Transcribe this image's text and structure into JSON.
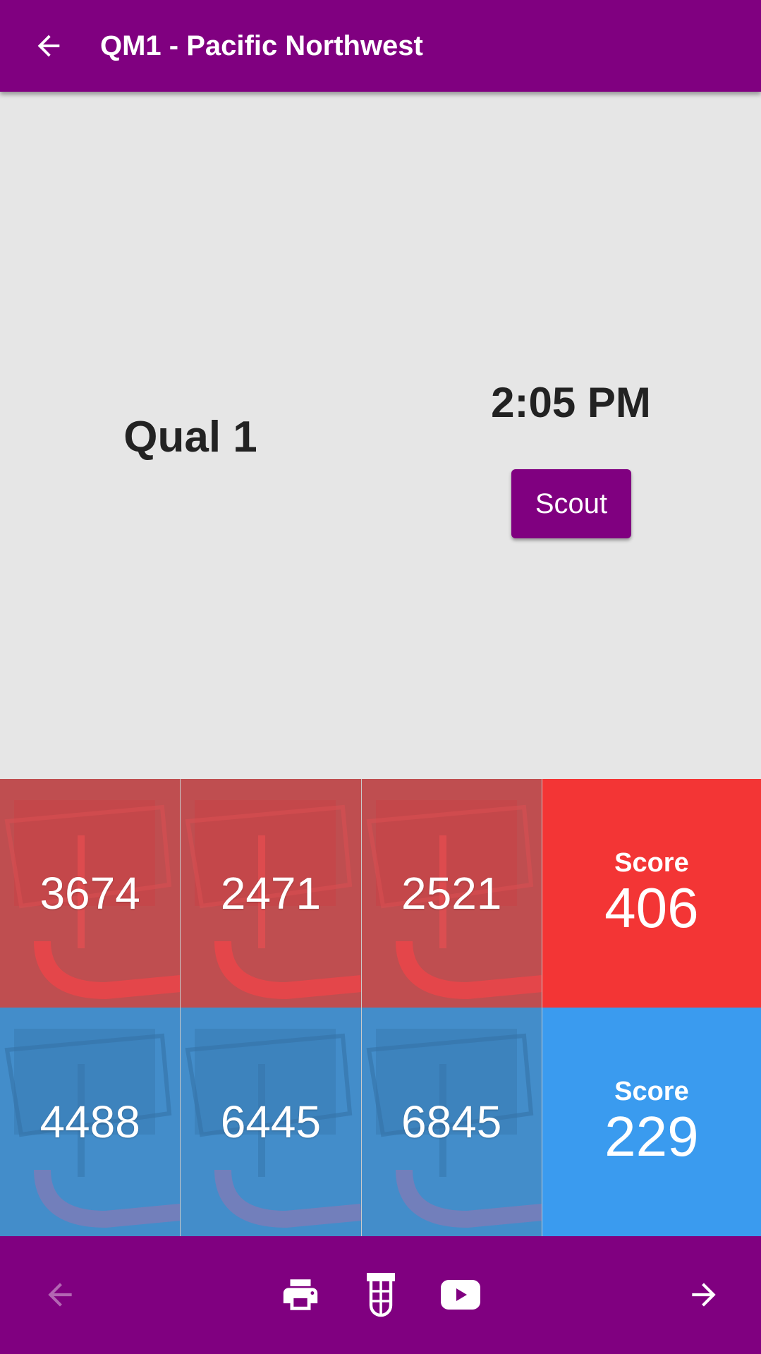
{
  "appbar": {
    "title": "QM1 - Pacific Northwest",
    "back_icon": "arrow-left-icon"
  },
  "match": {
    "name": "Qual 1",
    "time": "2:05 PM",
    "scout_label": "Scout"
  },
  "red_alliance": {
    "color": "#f33535",
    "teams": [
      "3674",
      "2471",
      "2521"
    ],
    "score_label": "Score",
    "score": "406"
  },
  "blue_alliance": {
    "color": "#3a9bef",
    "teams": [
      "4488",
      "6445",
      "6845"
    ],
    "score_label": "Score",
    "score": "229"
  },
  "bottombar": {
    "icons": [
      "arrow-left-icon",
      "printer-icon",
      "test-tube-icon",
      "youtube-icon",
      "arrow-right-icon"
    ],
    "prev_disabled": true
  },
  "colors": {
    "primary": "#800080",
    "background": "#e6e6e6"
  }
}
